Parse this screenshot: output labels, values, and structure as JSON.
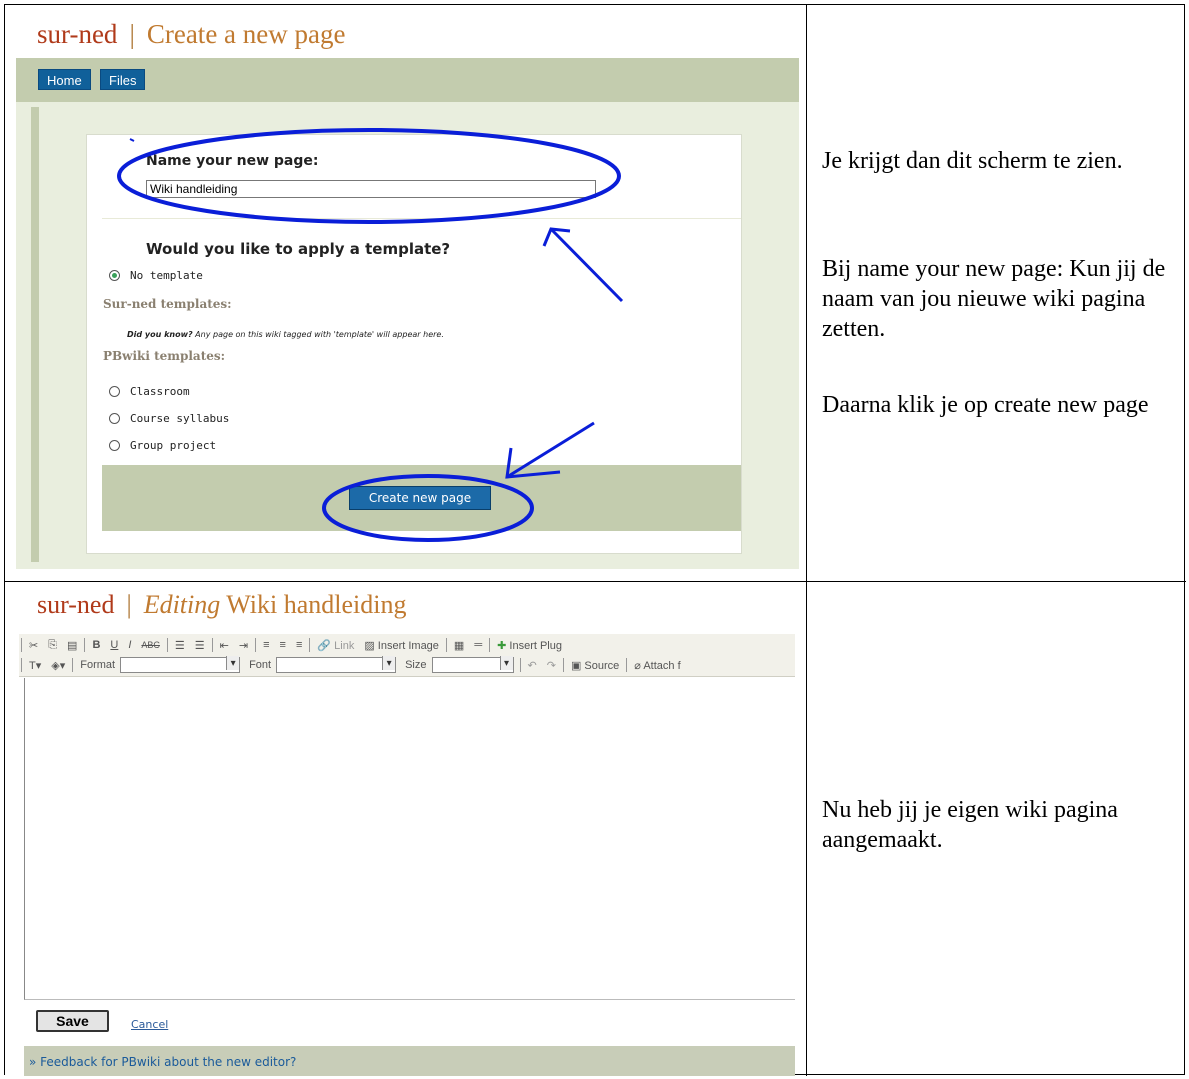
{
  "top_screenshot": {
    "site_name": "sur-ned",
    "separator": "|",
    "page_title": "Create a new page",
    "nav": [
      "Home",
      "Files"
    ],
    "name_heading": "Name your new page:",
    "name_value": "Wiki handleiding",
    "template_heading": "Would you like to apply a template?",
    "no_template_label": "No template",
    "surned_templates_heading": "Sur-ned templates:",
    "did_you_know_bold": "Did you know?",
    "did_you_know_text": " Any page on this wiki tagged with 'template' will appear here.",
    "pbwiki_templates_heading": "PBwiki templates:",
    "pbwiki_templates": [
      "Classroom",
      "Course syllabus",
      "Group project"
    ],
    "create_button": "Create new page",
    "annotation_color": "#0a1ed8"
  },
  "top_note": [
    "Je krijgt dan dit scherm te zien.",
    "Bij name your new page: Kun jij de naam van jou nieuwe wiki pagina zetten.",
    "Daarna klik je op create new page"
  ],
  "bottom_screenshot": {
    "site_name": "sur-ned",
    "separator": "|",
    "editing_label": "Editing",
    "page_name": "Wiki handleiding",
    "toolbar_row1": {
      "link": "Link",
      "insert_image": "Insert Image",
      "insert_plugin": "Insert Plug"
    },
    "toolbar_row2": {
      "format": "Format",
      "font": "Font",
      "size": "Size",
      "source": "Source",
      "attach": "Attach f"
    },
    "save_button": "Save",
    "cancel_link": "Cancel",
    "feedback_link": "» Feedback for PBwiki about the new editor?"
  },
  "bottom_note": "Nu heb jij je eigen wiki pagina aangemaakt."
}
